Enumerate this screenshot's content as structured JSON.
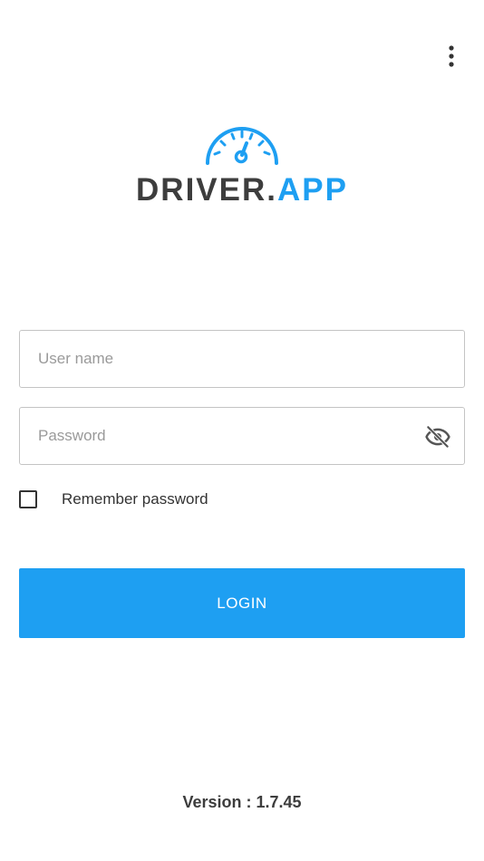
{
  "header": {
    "menu_icon": "more-vert-icon"
  },
  "logo": {
    "icon": "speedometer-icon",
    "text_dark": "DRIVER.",
    "text_accent": "APP",
    "colors": {
      "dark": "#3d3d3d",
      "accent": "#1e9ff2"
    }
  },
  "form": {
    "username": {
      "placeholder": "User name",
      "value": ""
    },
    "password": {
      "placeholder": "Password",
      "value": "",
      "toggle_icon": "visibility-off-icon"
    },
    "remember": {
      "label": "Remember password",
      "checked": false
    },
    "login_label": "LOGIN",
    "login_color": "#1e9ff2"
  },
  "footer": {
    "version": "Version : 1.7.45"
  }
}
